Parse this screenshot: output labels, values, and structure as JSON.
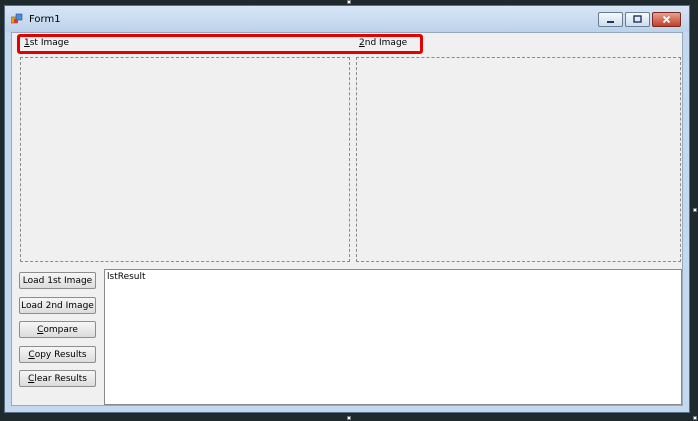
{
  "window": {
    "title": "Form1"
  },
  "labels": {
    "first_image": {
      "accel": "1",
      "rest": "st Image"
    },
    "second_image": {
      "accel": "2",
      "rest": "nd Image"
    }
  },
  "buttons": {
    "load_1st": {
      "text": "Load 1st Image"
    },
    "load_2nd": {
      "text": "Load 2nd Image"
    },
    "compare": {
      "accel": "C",
      "rest": "ompare"
    },
    "copy": {
      "accel": "C",
      "rest": "opy Results"
    },
    "clear": {
      "accel": "C",
      "rest": "lear Results"
    }
  },
  "listbox": {
    "placeholder_text": "lstResult"
  },
  "colors": {
    "highlight": "#e30000",
    "client_bg": "#f0f0f0",
    "titlebar": "#c5d9ee"
  },
  "icons": {
    "app": "form-app-icon",
    "minimize": "minimize-icon",
    "maximize": "maximize-icon",
    "close": "close-icon"
  }
}
